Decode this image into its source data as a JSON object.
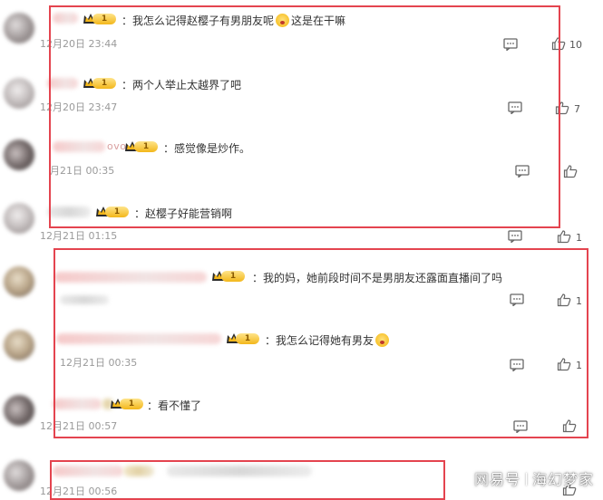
{
  "comments": [
    {
      "name_suffix": "",
      "text_before": "：我怎么记得赵樱子有男朋友呢",
      "text_after": "这是在干嘛",
      "time": "12月20日 23:44",
      "likes": "10"
    },
    {
      "name_suffix": "",
      "text_before": "：两个人举止太越界了吧",
      "text_after": "",
      "time": "12月20日 23:47",
      "likes": "7"
    },
    {
      "name_suffix": "ovo",
      "text_before": "：感觉像是炒作。",
      "text_after": "",
      "time": "月21日 00:35",
      "likes": ""
    },
    {
      "name_suffix": "",
      "text_before": "：赵樱子好能营销啊",
      "text_after": "",
      "time": "12月21日 01:15",
      "likes": "1"
    },
    {
      "name_suffix": "",
      "text_before": "：我的妈，她前段时间不是男朋友还露面直播间了吗",
      "text_after": "",
      "time": "",
      "likes": "1"
    },
    {
      "name_suffix": "",
      "text_before": "：我怎么记得她有男友",
      "text_after": "",
      "time": "12月21日 00:35",
      "likes": "1"
    },
    {
      "name_suffix": "",
      "text_before": "：看不懂了",
      "text_after": "",
      "time": "12月21日 00:57",
      "likes": ""
    },
    {
      "name_suffix": "",
      "text_before": "",
      "text_after": "",
      "time": "12月21日 00:56",
      "likes": ""
    }
  ],
  "badge_level": "1",
  "watermark": {
    "left": "网易号",
    "right": "海幻梦家"
  },
  "colors": {
    "highlight": "#e4444f",
    "badge": "#f3b71b",
    "time": "#9a9a9a"
  }
}
